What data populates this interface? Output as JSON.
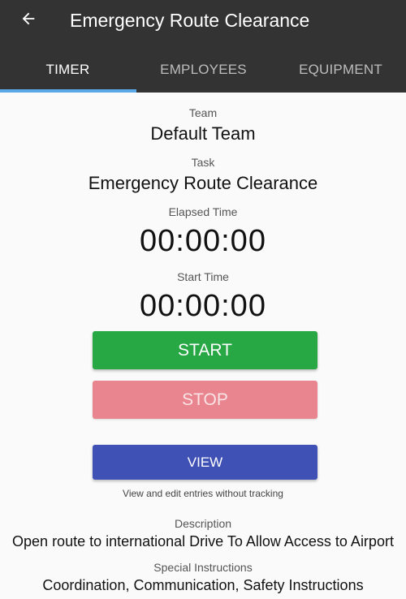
{
  "header": {
    "title": "Emergency Route Clearance",
    "back_icon": "arrow-left-icon"
  },
  "tabs": [
    {
      "label": "TIMER",
      "active": true
    },
    {
      "label": "EMPLOYEES",
      "active": false
    },
    {
      "label": "EQUIPMENT",
      "active": false
    }
  ],
  "colors": {
    "appbar": "#333333",
    "tab_indicator": "#5aa8e6",
    "start": "#28a745",
    "stop": "#e8858f",
    "view": "#3f51b5"
  },
  "timer": {
    "team_label": "Team",
    "team_value": "Default Team",
    "task_label": "Task",
    "task_value": "Emergency Route Clearance",
    "elapsed_label": "Elapsed Time",
    "elapsed_value": "00:00:00",
    "start_label": "Start Time",
    "start_value": "00:00:00"
  },
  "buttons": {
    "start": "START",
    "stop": "STOP",
    "view": "VIEW",
    "view_hint": "View and edit entries without tracking"
  },
  "details": {
    "description_label": "Description",
    "description_value": "Open route to international Drive To Allow Access to Airport",
    "instructions_label": "Special Instructions",
    "instructions_value": "Coordination, Communication, Safety Instructions"
  }
}
